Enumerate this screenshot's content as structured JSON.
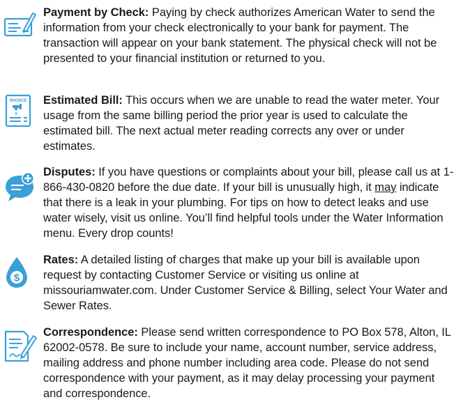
{
  "colors": {
    "icon_blue": "#3b9fd8",
    "text": "#1a1a1a"
  },
  "sections": [
    {
      "icon": "check-icon",
      "heading": "Payment by Check:",
      "body": " Paying by check authorizes American Water to send the information from your check electronically to your bank for payment. The transaction will appear on your bank statement. The physical check will not be presented to your financial institution or returned to you."
    },
    {
      "icon": "invoice-icon",
      "icon_label": "INVOICE",
      "heading": "Estimated Bill:",
      "body": " This occurs when we are unable to read the water meter. Your usage from the same billing period the prior year is used to calculate the estimated bill. The next actual meter reading corrects any over or under estimates."
    },
    {
      "icon": "chat-bubble-icon",
      "heading": "Disputes:",
      "body_a": " If you have questions or complaints about your bill, please call us at 1-866-430-0820 before the due date. If your bill is unusually high, it ",
      "body_u": "may",
      "body_b": " indicate that there is a leak in your plumbing. For tips on how to detect leaks and use water wisely, visit us online. You’ll find helpful tools under the Water Information menu. Every drop counts!"
    },
    {
      "icon": "water-drop-dollar-icon",
      "icon_label": "$",
      "heading": "Rates:",
      "body": " A detailed listing of charges that make up your bill is available upon request by contacting Customer Service or visiting us online at missouriamwater.com. Under Customer Service & Billing, select Your Water and Sewer Rates."
    },
    {
      "icon": "document-pen-icon",
      "heading": "Correspondence:",
      "body": " Please send written correspondence to PO Box 578, Alton, IL 62002-0578. Be sure to include your name, account number, service address, mailing address and phone number including area code. Please do not send correspondence with your payment, as it may delay processing your payment and correspondence."
    }
  ]
}
